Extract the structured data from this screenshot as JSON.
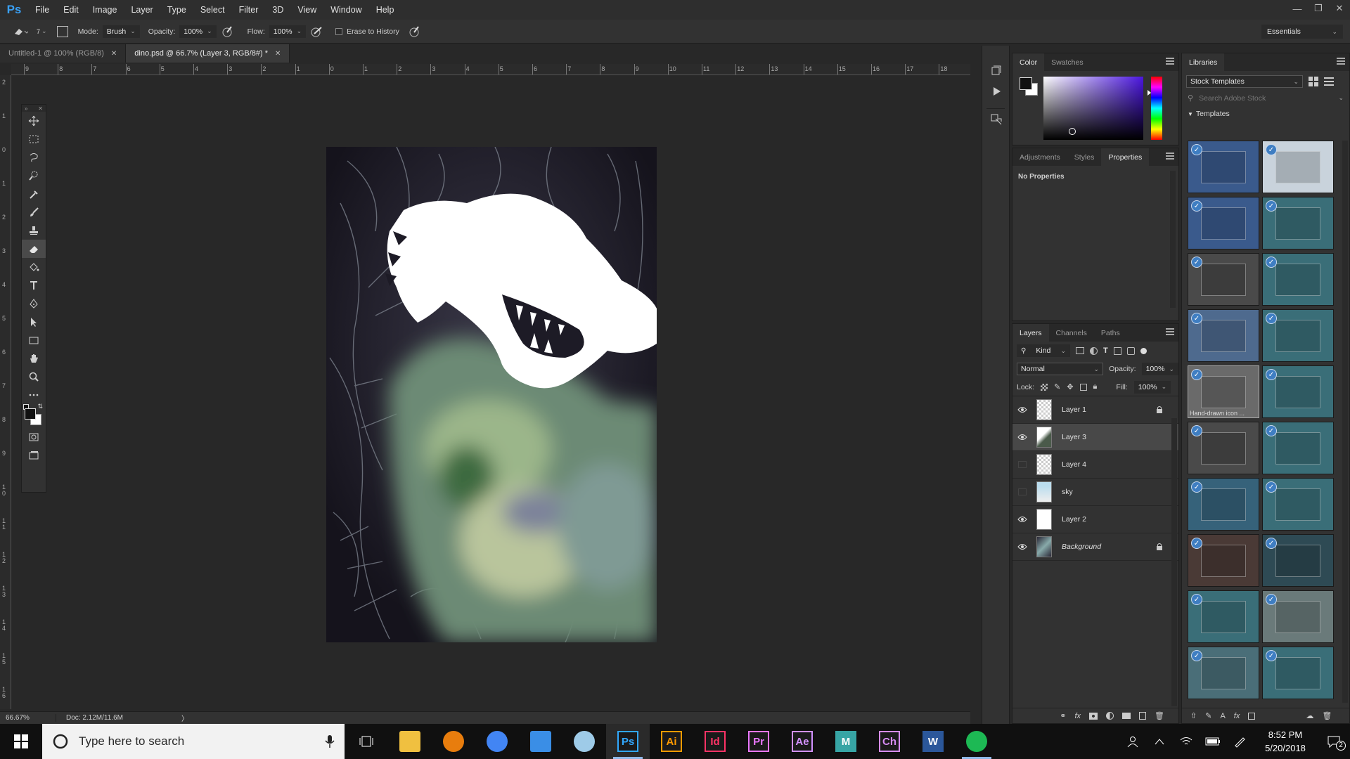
{
  "app": {
    "logo": "Ps"
  },
  "menu": [
    "File",
    "Edit",
    "Image",
    "Layer",
    "Type",
    "Select",
    "Filter",
    "3D",
    "View",
    "Window",
    "Help"
  ],
  "options": {
    "brush_size": "7",
    "mode_label": "Mode:",
    "mode_value": "Brush",
    "opacity_label": "Opacity:",
    "opacity_value": "100%",
    "flow_label": "Flow:",
    "flow_value": "100%",
    "erase_history_label": "Erase to History",
    "workspace": "Essentials"
  },
  "tabs": [
    {
      "label": "Untitled-1 @ 100% (RGB/8)",
      "active": false
    },
    {
      "label": "dino.psd @ 66.7% (Layer 3, RGB/8#) *",
      "active": true
    }
  ],
  "ruler": {
    "top": [
      "9",
      "8",
      "7",
      "6",
      "5",
      "4",
      "3",
      "2",
      "1",
      "0",
      "1",
      "2",
      "3",
      "4",
      "5",
      "6",
      "7",
      "8",
      "9",
      "10",
      "11",
      "12",
      "13",
      "14",
      "15",
      "16",
      "17",
      "18"
    ],
    "left": [
      "2",
      "1",
      "0",
      "1",
      "2",
      "3",
      "4",
      "5",
      "6",
      "7",
      "8",
      "9",
      "1\n0",
      "1\n1",
      "1\n2",
      "1\n3",
      "1\n4",
      "1\n5",
      "1\n6"
    ]
  },
  "status": {
    "zoom": "66.67%",
    "doc": "Doc: 2.12M/11.6M",
    "arrow": "〉"
  },
  "color_panel": {
    "tabs": [
      "Color",
      "Swatches"
    ],
    "foreground": "#111111",
    "background": "#ffffff"
  },
  "props_panel": {
    "tabs": [
      "Adjustments",
      "Styles",
      "Properties"
    ],
    "message": "No Properties"
  },
  "layers_panel": {
    "tabs": [
      "Layers",
      "Channels",
      "Paths"
    ],
    "filter_kind": "Kind",
    "blend_mode": "Normal",
    "opacity_label": "Opacity:",
    "opacity_value": "100%",
    "lock_label": "Lock:",
    "fill_label": "Fill:",
    "fill_value": "100%",
    "layers": [
      {
        "name": "Layer 1",
        "visible": true,
        "locked": true,
        "selected": false,
        "italic": false
      },
      {
        "name": "Layer 3",
        "visible": true,
        "locked": false,
        "selected": true,
        "italic": false
      },
      {
        "name": "Layer 4",
        "visible": false,
        "locked": false,
        "selected": false,
        "italic": false
      },
      {
        "name": "sky",
        "visible": false,
        "locked": false,
        "selected": false,
        "italic": false
      },
      {
        "name": "Layer 2",
        "visible": true,
        "locked": false,
        "selected": false,
        "italic": false
      },
      {
        "name": "Background",
        "visible": true,
        "locked": true,
        "selected": false,
        "italic": true
      }
    ]
  },
  "libraries": {
    "title": "Libraries",
    "source": "Stock Templates",
    "search_placeholder": "Search Adobe Stock",
    "section": "Templates",
    "hover_caption": "Hand-drawn icon ..."
  },
  "taskbar": {
    "search_placeholder": "Type here to search",
    "apps": [
      {
        "name": "file-explorer",
        "label": "",
        "color": "#f0c040",
        "open": false
      },
      {
        "name": "blender",
        "label": "",
        "color": "#e87d0d",
        "open": false
      },
      {
        "name": "chrome",
        "label": "",
        "color": "#4285f4",
        "open": false
      },
      {
        "name": "store",
        "label": "",
        "color": "#3a8ee6",
        "open": false
      },
      {
        "name": "paint",
        "label": "",
        "color": "#9ecbe8",
        "open": false
      },
      {
        "name": "photoshop",
        "label": "Ps",
        "color": "#31a8ff",
        "open": true
      },
      {
        "name": "illustrator",
        "label": "Ai",
        "color": "#ff9a00",
        "open": false
      },
      {
        "name": "indesign",
        "label": "Id",
        "color": "#ff3366",
        "open": false
      },
      {
        "name": "premiere",
        "label": "Pr",
        "color": "#ea77ff",
        "open": false
      },
      {
        "name": "after-effects",
        "label": "Ae",
        "color": "#d291ff",
        "open": false
      },
      {
        "name": "maya",
        "label": "M",
        "color": "#37a5a5",
        "open": false
      },
      {
        "name": "character-animator",
        "label": "Ch",
        "color": "#d78cf5",
        "open": false
      },
      {
        "name": "word",
        "label": "W",
        "color": "#2b579a",
        "open": false
      },
      {
        "name": "spotify",
        "label": "",
        "color": "#1db954",
        "open": true
      }
    ],
    "time": "8:52 PM",
    "date": "5/20/2018",
    "notifications": "2"
  }
}
